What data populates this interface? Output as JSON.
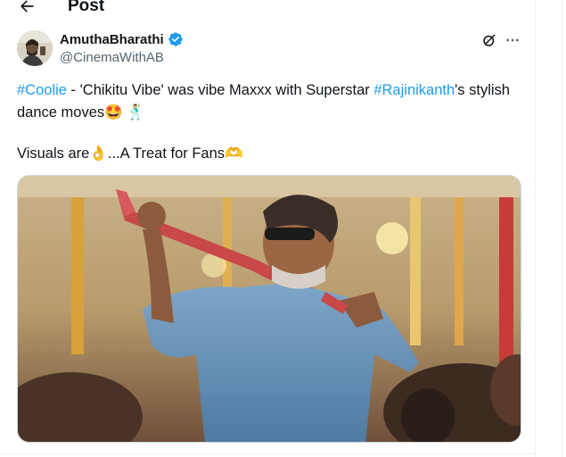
{
  "header": {
    "title": "Post",
    "back_icon": "arrow-left-icon"
  },
  "author": {
    "name": "AmuthaBharathi",
    "handle": "@CinemaWithAB",
    "verified": true,
    "verified_color": "#1d9bf0"
  },
  "actions": {
    "grok_icon": "grok-icon",
    "more_icon": "more-icon"
  },
  "tweet": {
    "hashtag1": "#Coolie",
    "text1": " - 'Chikitu Vibe' was vibe Maxxx with Superstar ",
    "hashtag2": "#Rajinikanth",
    "text2": "'s stylish dance moves",
    "emoji1": "🤩",
    "emoji2": "🕺",
    "line2_text": "Visuals are",
    "emoji3": "👌",
    "line2_text2": "...A Treat for Fans",
    "emoji4": "🫶"
  },
  "colors": {
    "link": "#1d9bf0",
    "text": "#0f1419",
    "secondary": "#536471"
  }
}
